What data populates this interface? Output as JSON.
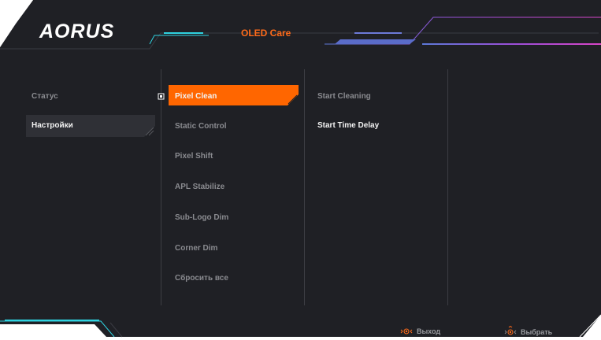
{
  "header": {
    "brand": "AORUS",
    "title": "OLED Care"
  },
  "left_menu": {
    "items": [
      {
        "label": "Статус",
        "selected": false
      },
      {
        "label": "Настройки",
        "selected": true
      }
    ]
  },
  "middle_menu": {
    "items": [
      {
        "label": "Pixel Clean",
        "selected": true
      },
      {
        "label": "Static Control",
        "selected": false
      },
      {
        "label": "Pixel Shift",
        "selected": false
      },
      {
        "label": "APL Stabilize",
        "selected": false
      },
      {
        "label": "Sub-Logo Dim",
        "selected": false
      },
      {
        "label": "Corner Dim",
        "selected": false
      },
      {
        "label": "Сбросить все",
        "selected": false
      }
    ]
  },
  "right_menu": {
    "items": [
      {
        "label": "Start Cleaning",
        "selected": false
      },
      {
        "label": "Start Time Delay",
        "selected": true
      }
    ]
  },
  "footer": {
    "exit_label": "Выход",
    "select_label": "Выбрать"
  },
  "colors": {
    "background": "#1f2025",
    "accent": "#ff6600",
    "cyan": "#2fd1df",
    "purple": "#8c4dd6",
    "magenta": "#c43ec8"
  },
  "icons": [
    "joystick-icon",
    "joystick-press-icon",
    "checkbox-marker-icon"
  ]
}
